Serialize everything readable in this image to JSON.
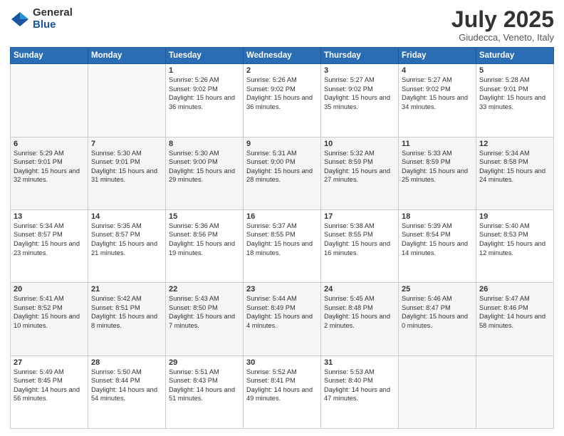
{
  "logo": {
    "general": "General",
    "blue": "Blue"
  },
  "header": {
    "month": "July 2025",
    "location": "Giudecca, Veneto, Italy"
  },
  "weekdays": [
    "Sunday",
    "Monday",
    "Tuesday",
    "Wednesday",
    "Thursday",
    "Friday",
    "Saturday"
  ],
  "weeks": [
    [
      {
        "day": "",
        "sunrise": "",
        "sunset": "",
        "daylight": ""
      },
      {
        "day": "",
        "sunrise": "",
        "sunset": "",
        "daylight": ""
      },
      {
        "day": "1",
        "sunrise": "Sunrise: 5:26 AM",
        "sunset": "Sunset: 9:02 PM",
        "daylight": "Daylight: 15 hours and 36 minutes."
      },
      {
        "day": "2",
        "sunrise": "Sunrise: 5:26 AM",
        "sunset": "Sunset: 9:02 PM",
        "daylight": "Daylight: 15 hours and 36 minutes."
      },
      {
        "day": "3",
        "sunrise": "Sunrise: 5:27 AM",
        "sunset": "Sunset: 9:02 PM",
        "daylight": "Daylight: 15 hours and 35 minutes."
      },
      {
        "day": "4",
        "sunrise": "Sunrise: 5:27 AM",
        "sunset": "Sunset: 9:02 PM",
        "daylight": "Daylight: 15 hours and 34 minutes."
      },
      {
        "day": "5",
        "sunrise": "Sunrise: 5:28 AM",
        "sunset": "Sunset: 9:01 PM",
        "daylight": "Daylight: 15 hours and 33 minutes."
      }
    ],
    [
      {
        "day": "6",
        "sunrise": "Sunrise: 5:29 AM",
        "sunset": "Sunset: 9:01 PM",
        "daylight": "Daylight: 15 hours and 32 minutes."
      },
      {
        "day": "7",
        "sunrise": "Sunrise: 5:30 AM",
        "sunset": "Sunset: 9:01 PM",
        "daylight": "Daylight: 15 hours and 31 minutes."
      },
      {
        "day": "8",
        "sunrise": "Sunrise: 5:30 AM",
        "sunset": "Sunset: 9:00 PM",
        "daylight": "Daylight: 15 hours and 29 minutes."
      },
      {
        "day": "9",
        "sunrise": "Sunrise: 5:31 AM",
        "sunset": "Sunset: 9:00 PM",
        "daylight": "Daylight: 15 hours and 28 minutes."
      },
      {
        "day": "10",
        "sunrise": "Sunrise: 5:32 AM",
        "sunset": "Sunset: 8:59 PM",
        "daylight": "Daylight: 15 hours and 27 minutes."
      },
      {
        "day": "11",
        "sunrise": "Sunrise: 5:33 AM",
        "sunset": "Sunset: 8:59 PM",
        "daylight": "Daylight: 15 hours and 25 minutes."
      },
      {
        "day": "12",
        "sunrise": "Sunrise: 5:34 AM",
        "sunset": "Sunset: 8:58 PM",
        "daylight": "Daylight: 15 hours and 24 minutes."
      }
    ],
    [
      {
        "day": "13",
        "sunrise": "Sunrise: 5:34 AM",
        "sunset": "Sunset: 8:57 PM",
        "daylight": "Daylight: 15 hours and 23 minutes."
      },
      {
        "day": "14",
        "sunrise": "Sunrise: 5:35 AM",
        "sunset": "Sunset: 8:57 PM",
        "daylight": "Daylight: 15 hours and 21 minutes."
      },
      {
        "day": "15",
        "sunrise": "Sunrise: 5:36 AM",
        "sunset": "Sunset: 8:56 PM",
        "daylight": "Daylight: 15 hours and 19 minutes."
      },
      {
        "day": "16",
        "sunrise": "Sunrise: 5:37 AM",
        "sunset": "Sunset: 8:55 PM",
        "daylight": "Daylight: 15 hours and 18 minutes."
      },
      {
        "day": "17",
        "sunrise": "Sunrise: 5:38 AM",
        "sunset": "Sunset: 8:55 PM",
        "daylight": "Daylight: 15 hours and 16 minutes."
      },
      {
        "day": "18",
        "sunrise": "Sunrise: 5:39 AM",
        "sunset": "Sunset: 8:54 PM",
        "daylight": "Daylight: 15 hours and 14 minutes."
      },
      {
        "day": "19",
        "sunrise": "Sunrise: 5:40 AM",
        "sunset": "Sunset: 8:53 PM",
        "daylight": "Daylight: 15 hours and 12 minutes."
      }
    ],
    [
      {
        "day": "20",
        "sunrise": "Sunrise: 5:41 AM",
        "sunset": "Sunset: 8:52 PM",
        "daylight": "Daylight: 15 hours and 10 minutes."
      },
      {
        "day": "21",
        "sunrise": "Sunrise: 5:42 AM",
        "sunset": "Sunset: 8:51 PM",
        "daylight": "Daylight: 15 hours and 8 minutes."
      },
      {
        "day": "22",
        "sunrise": "Sunrise: 5:43 AM",
        "sunset": "Sunset: 8:50 PM",
        "daylight": "Daylight: 15 hours and 7 minutes."
      },
      {
        "day": "23",
        "sunrise": "Sunrise: 5:44 AM",
        "sunset": "Sunset: 8:49 PM",
        "daylight": "Daylight: 15 hours and 4 minutes."
      },
      {
        "day": "24",
        "sunrise": "Sunrise: 5:45 AM",
        "sunset": "Sunset: 8:48 PM",
        "daylight": "Daylight: 15 hours and 2 minutes."
      },
      {
        "day": "25",
        "sunrise": "Sunrise: 5:46 AM",
        "sunset": "Sunset: 8:47 PM",
        "daylight": "Daylight: 15 hours and 0 minutes."
      },
      {
        "day": "26",
        "sunrise": "Sunrise: 5:47 AM",
        "sunset": "Sunset: 8:46 PM",
        "daylight": "Daylight: 14 hours and 58 minutes."
      }
    ],
    [
      {
        "day": "27",
        "sunrise": "Sunrise: 5:49 AM",
        "sunset": "Sunset: 8:45 PM",
        "daylight": "Daylight: 14 hours and 56 minutes."
      },
      {
        "day": "28",
        "sunrise": "Sunrise: 5:50 AM",
        "sunset": "Sunset: 8:44 PM",
        "daylight": "Daylight: 14 hours and 54 minutes."
      },
      {
        "day": "29",
        "sunrise": "Sunrise: 5:51 AM",
        "sunset": "Sunset: 8:43 PM",
        "daylight": "Daylight: 14 hours and 51 minutes."
      },
      {
        "day": "30",
        "sunrise": "Sunrise: 5:52 AM",
        "sunset": "Sunset: 8:41 PM",
        "daylight": "Daylight: 14 hours and 49 minutes."
      },
      {
        "day": "31",
        "sunrise": "Sunrise: 5:53 AM",
        "sunset": "Sunset: 8:40 PM",
        "daylight": "Daylight: 14 hours and 47 minutes."
      },
      {
        "day": "",
        "sunrise": "",
        "sunset": "",
        "daylight": ""
      },
      {
        "day": "",
        "sunrise": "",
        "sunset": "",
        "daylight": ""
      }
    ]
  ]
}
